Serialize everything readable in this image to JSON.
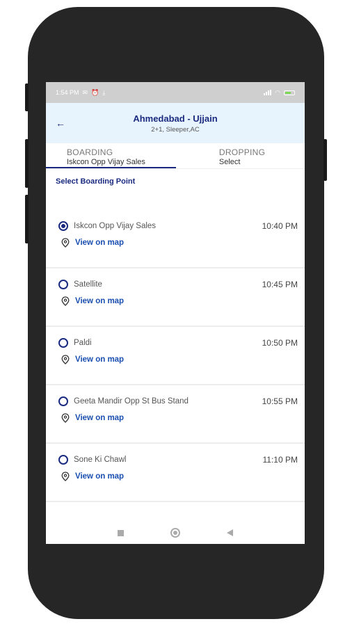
{
  "status": {
    "time": "1:54 PM"
  },
  "header": {
    "route": "Ahmedabad - Ujjain",
    "subtitle": "2+1, Sleeper,AC"
  },
  "tabs": [
    {
      "title": "BOARDING",
      "value": "Iskcon Opp Vijay Sales"
    },
    {
      "title": "DROPPING",
      "value": "Select"
    }
  ],
  "section_title": "Select Boarding Point",
  "boarding_points": [
    {
      "name": "Iskcon Opp Vijay Sales",
      "time": "10:40 PM",
      "map_label": "View on map",
      "selected": true
    },
    {
      "name": "Satellite",
      "time": "10:45 PM",
      "map_label": "View on map",
      "selected": false
    },
    {
      "name": "Paldi",
      "time": "10:50 PM",
      "map_label": "View on map",
      "selected": false
    },
    {
      "name": "Geeta Mandir Opp St Bus Stand",
      "time": "10:55 PM",
      "map_label": "View on map",
      "selected": false
    },
    {
      "name": "Sone Ki Chawl",
      "time": "11:10 PM",
      "map_label": "View on map",
      "selected": false
    }
  ],
  "colors": {
    "accent": "#1a2a80",
    "header_bg": "#e8f4fd",
    "link": "#1a4fb0",
    "phone_body": "#262626"
  }
}
